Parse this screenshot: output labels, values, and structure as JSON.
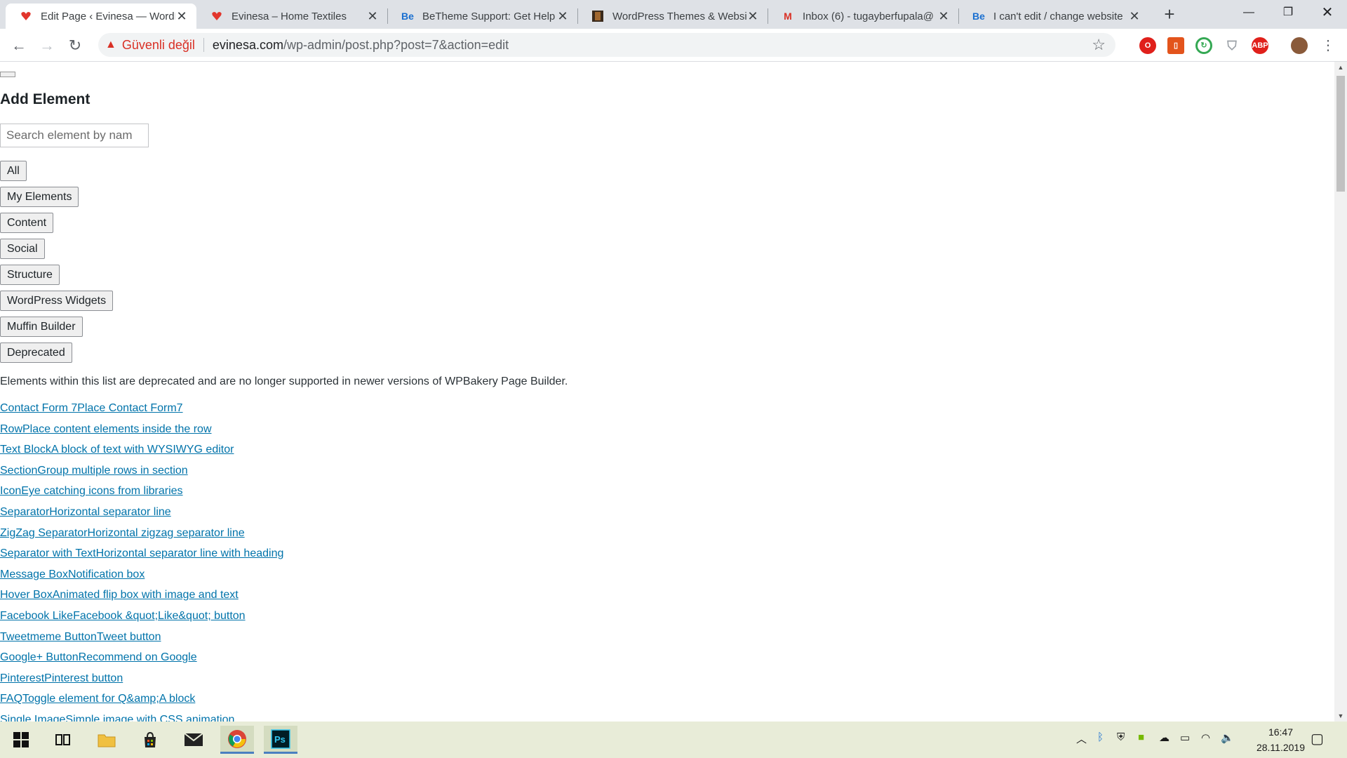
{
  "browser": {
    "tabs": [
      {
        "title": "Edit Page ‹ Evinesa — WordP",
        "favicon": "heart-icon",
        "active": true
      },
      {
        "title": "Evinesa – Home Textiles",
        "favicon": "heart-icon",
        "active": false
      },
      {
        "title": "BeTheme Support: Get Help",
        "favicon": "Be",
        "active": false
      },
      {
        "title": "WordPress Themes & Websit",
        "favicon": "thumbnail-icon",
        "active": false
      },
      {
        "title": "Inbox (6) - tugayberfupala@",
        "favicon": "M",
        "active": false
      },
      {
        "title": "I can't edit / change website",
        "favicon": "Be",
        "active": false
      }
    ],
    "address": {
      "security_label": "Güvenli değil",
      "url_domain": "evinesa.com",
      "url_path": "/wp-admin/post.php?post=7&action=edit"
    },
    "extensions": [
      "opera-icon",
      "office-icon",
      "sync-icon",
      "shield-icon",
      "ABP",
      "avatar-icon"
    ]
  },
  "panel": {
    "title": "Add Element",
    "search_placeholder": "Search element by nam",
    "categories": [
      "All",
      "My Elements",
      "Content",
      "Social",
      "Structure",
      "WordPress Widgets",
      "Muffin Builder",
      "Deprecated"
    ],
    "note": "Elements within this list are deprecated and are no longer supported in newer versions of WPBakery Page Builder.",
    "elements": [
      "Contact Form 7Place Contact Form7",
      "RowPlace content elements inside the row",
      "Text BlockA block of text with WYSIWYG editor",
      "SectionGroup multiple rows in section",
      "IconEye catching icons from libraries",
      "SeparatorHorizontal separator line",
      "ZigZag SeparatorHorizontal zigzag separator line",
      "Separator with TextHorizontal separator line with heading",
      "Message BoxNotification box",
      "Hover BoxAnimated flip box with image and text",
      "Facebook LikeFacebook &quot;Like&quot; button",
      "Tweetmeme ButtonTweet button",
      "Google+ ButtonRecommend on Google",
      "PinterestPinterest button",
      "FAQToggle element for Q&amp;A block",
      "Single ImageSimple image with CSS animation"
    ]
  },
  "taskbar": {
    "time": "16:47",
    "date": "28.11.2019"
  },
  "colors": {
    "link": "#0073aa",
    "insecure": "#d93025",
    "taskbar": "#e8ecd8"
  }
}
